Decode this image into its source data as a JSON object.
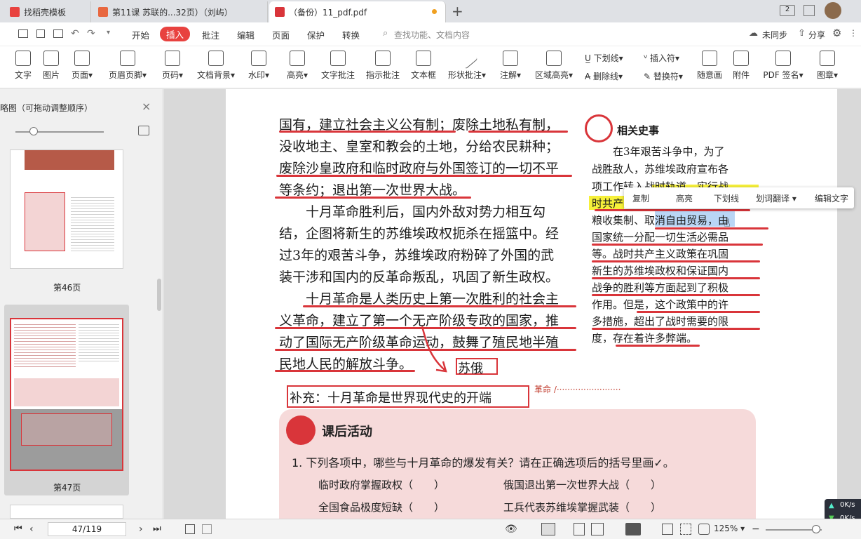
{
  "tabs": [
    {
      "label": "找稻壳模板"
    },
    {
      "label": "第11课 苏联的...32页）（刘屿）"
    },
    {
      "label": "（备份）11_pdf.pdf"
    }
  ],
  "window": {
    "badge": "2"
  },
  "menu": {
    "items": [
      "开始",
      "插入",
      "批注",
      "编辑",
      "页面",
      "保护",
      "转换"
    ],
    "active": "插入",
    "search_placeholder": "查找功能、文档内容",
    "sync": "未同步",
    "share": "分享"
  },
  "ribbon": {
    "buttons": [
      "文字",
      "图片",
      "页面",
      "页眉页脚",
      "页码",
      "文档背景",
      "水印",
      "高亮",
      "文字批注",
      "指示批注",
      "文本框",
      "形状批注",
      "注解",
      "区域高亮",
      "随意画",
      "附件",
      "PDF 签名",
      "图章"
    ],
    "small": [
      "下划线",
      "插入符",
      "删除线",
      "替换符"
    ]
  },
  "sidebar": {
    "title": "略图（可拖动调整顺序）",
    "pages": [
      "第46页",
      "第47页"
    ]
  },
  "document": {
    "main_lines": [
      "国有，建立社会主义公有制；废除土地私有制，",
      "没收地主、皇室和教会的土地，分给农民耕种；",
      "废除沙皇政府和临时政府与外国签订的一切不平",
      "等条约；退出第一次世界大战。",
      "　　十月革命胜利后，国内外敌对势力相互勾",
      "结，企图将新生的苏维埃政权扼杀在摇篮中。经",
      "过3年的艰苦斗争，苏维埃政府粉碎了外国的武",
      "装干涉和国内的反革命叛乱，巩固了新生政权。",
      "　　十月革命是人类历史上第一次胜利的社会主",
      "义革命，建立了第一个无产阶级专政的国家，推",
      "动了国际无产阶级革命运动，鼓舞了殖民地半殖",
      "民地人民的解放斗争。"
    ],
    "side_title": "相关史事",
    "side_lines": [
      "　　在3年艰苦斗争中，为了",
      "战胜敌人，苏维埃政府宣布各",
      "项工作转入战时轨道，实行战",
      "时共产",
      "粮收集制、取消自由贸易，由",
      "国家统一分配一切生活必需品",
      "等。战时共产主义政策在巩固",
      "新生的苏维埃政权和保证国内",
      "战争的胜利等方面起到了积极",
      "作用。但是，这个政策中的许",
      "多措施，超出了战时需要的限",
      "度，存在着许多弊端。"
    ],
    "annotation_box": "苏俄",
    "supplement": "补充：十月革命是世界现代史的开端",
    "dotted_caption": "革命 /",
    "activity_title": "课后活动",
    "question": "1. 下列各项中，哪些与十月革命的爆发有关？请在正确选项后的括号里画✓。",
    "options": [
      "临时政府掌握政权（　　）",
      "俄国退出第一次世界大战（　　）",
      "全国食品极度短缺（　　）",
      "工兵代表苏维埃掌握武装（　　）"
    ]
  },
  "context_menu": [
    "复制",
    "高亮",
    "下划线",
    "划词翻译",
    "编辑文字"
  ],
  "status": {
    "page_input": "47/119",
    "zoom": "125%",
    "net_up": "0K/s",
    "net_down": "0K/s"
  },
  "colors": {
    "accent": "#e8423f",
    "annotation": "#d9353a",
    "highlight": "#f6f03a",
    "selection": "#b9d6f5",
    "activity_bg": "#f6dada"
  }
}
